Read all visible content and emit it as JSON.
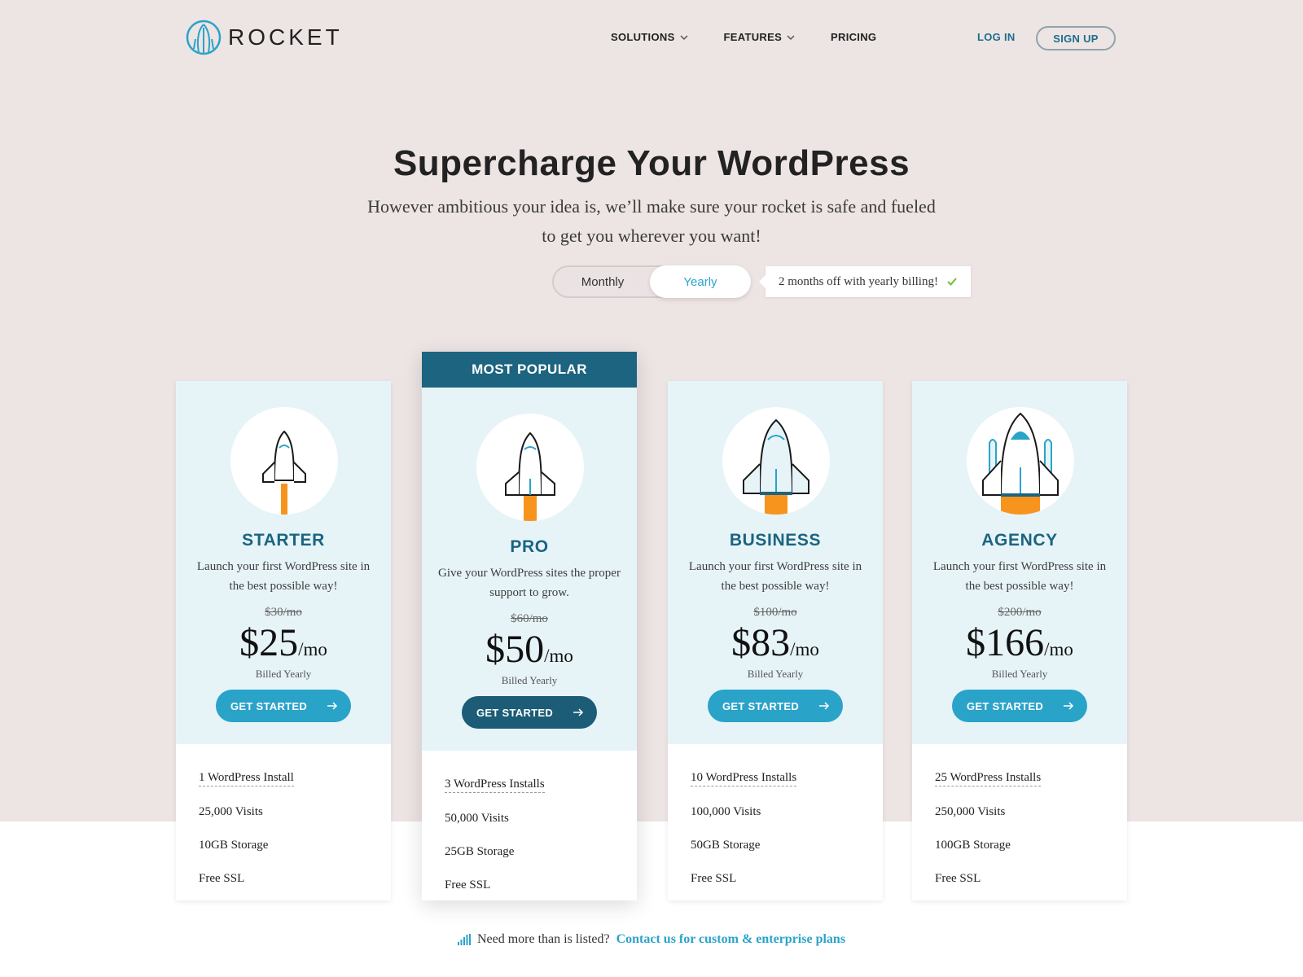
{
  "brand": {
    "name": "ROCKET",
    "accent": "#2aa3c9",
    "dark": "#1c6480"
  },
  "nav": {
    "items": [
      {
        "label": "SOLUTIONS",
        "has_dropdown": true
      },
      {
        "label": "FEATURES",
        "has_dropdown": true
      },
      {
        "label": "PRICING",
        "has_dropdown": false
      }
    ],
    "login": "LOG IN",
    "signup": "SIGN UP"
  },
  "hero": {
    "title": "Supercharge Your WordPress",
    "subtitle": "However ambitious your idea is, we’ll make sure your rocket is safe and fueled to get you wherever you want!"
  },
  "billing_toggle": {
    "options": [
      "Monthly",
      "Yearly"
    ],
    "selected": "Yearly",
    "promo": "2 months off with yearly billing!"
  },
  "plans": [
    {
      "name": "STARTER",
      "description": "Launch your first WordPress site in the best possible way!",
      "old_price": "$30/mo",
      "price": "$25",
      "per": "/mo",
      "billed": "Billed Yearly",
      "cta": "GET STARTED",
      "features": [
        "1 WordPress Install",
        "25,000 Visits",
        "10GB Storage",
        "Free SSL"
      ]
    },
    {
      "name": "PRO",
      "badge": "MOST POPULAR",
      "description": "Give your WordPress sites the proper support to grow.",
      "old_price": "$60/mo",
      "price": "$50",
      "per": "/mo",
      "billed": "Billed Yearly",
      "cta": "GET STARTED",
      "features": [
        "3 WordPress Installs",
        "50,000 Visits",
        "25GB Storage",
        "Free SSL"
      ]
    },
    {
      "name": "BUSINESS",
      "description": "Launch your first WordPress site in the best possible way!",
      "old_price": "$100/mo",
      "price": "$83",
      "per": "/mo",
      "billed": "Billed Yearly",
      "cta": "GET STARTED",
      "features": [
        "10 WordPress Installs",
        "100,000 Visits",
        "50GB Storage",
        "Free SSL"
      ]
    },
    {
      "name": "AGENCY",
      "description": "Launch your first WordPress site in the best possible way!",
      "old_price": "$200/mo",
      "price": "$166",
      "per": "/mo",
      "billed": "Billed Yearly",
      "cta": "GET STARTED",
      "features": [
        "25 WordPress Installs",
        "250,000 Visits",
        "100GB Storage",
        "Free SSL"
      ]
    }
  ],
  "footer_note": {
    "text": "Need more than is listed?",
    "link": "Contact us for custom & enterprise plans"
  }
}
